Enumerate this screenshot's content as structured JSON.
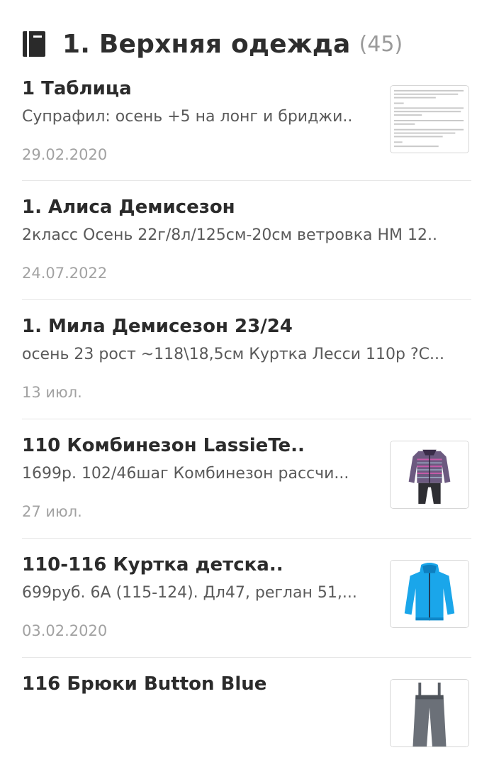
{
  "notebook": {
    "icon": "notebook-icon",
    "title": "1. Верхняя одежда",
    "count": "(45)"
  },
  "notes": [
    {
      "title": "1 Таблица",
      "snippet": "Супрафил: осень +5 на лонг и бриджи..",
      "date": "29.02.2020",
      "thumbnail": "table-document-thumbnail"
    },
    {
      "title": "1. Алиса Демисезон",
      "snippet": "2класс Осень 22г/8л/125см-20см ветровка НМ 12..",
      "date": "24.07.2022",
      "thumbnail": ""
    },
    {
      "title": "1. Мила Демисезон 23/24",
      "snippet": "осень 23 рост ~118\\18,5см Куртка Лесси 110р ?С...",
      "date": "13 июл.",
      "thumbnail": ""
    },
    {
      "title": "110 Комбинезон LassieTe..",
      "snippet": "1699р. 102/46шаг Комбинезон рассчи...",
      "date": "27 июл.",
      "thumbnail": "snowsuit-photo"
    },
    {
      "title": "110-116 Куртка детска..",
      "snippet": "699руб. 6А (115-124). Дл47, реглан 51,...",
      "date": "03.02.2020",
      "thumbnail": "blue-jacket-photo"
    },
    {
      "title": "116 Брюки Button Blue",
      "snippet": "",
      "date": "",
      "thumbnail": "pants-photo"
    }
  ],
  "colors": {
    "title": "#2b2b2b",
    "snippet": "#5a5a5a",
    "date": "#a2a2a2",
    "divider": "#e6e6e6"
  }
}
